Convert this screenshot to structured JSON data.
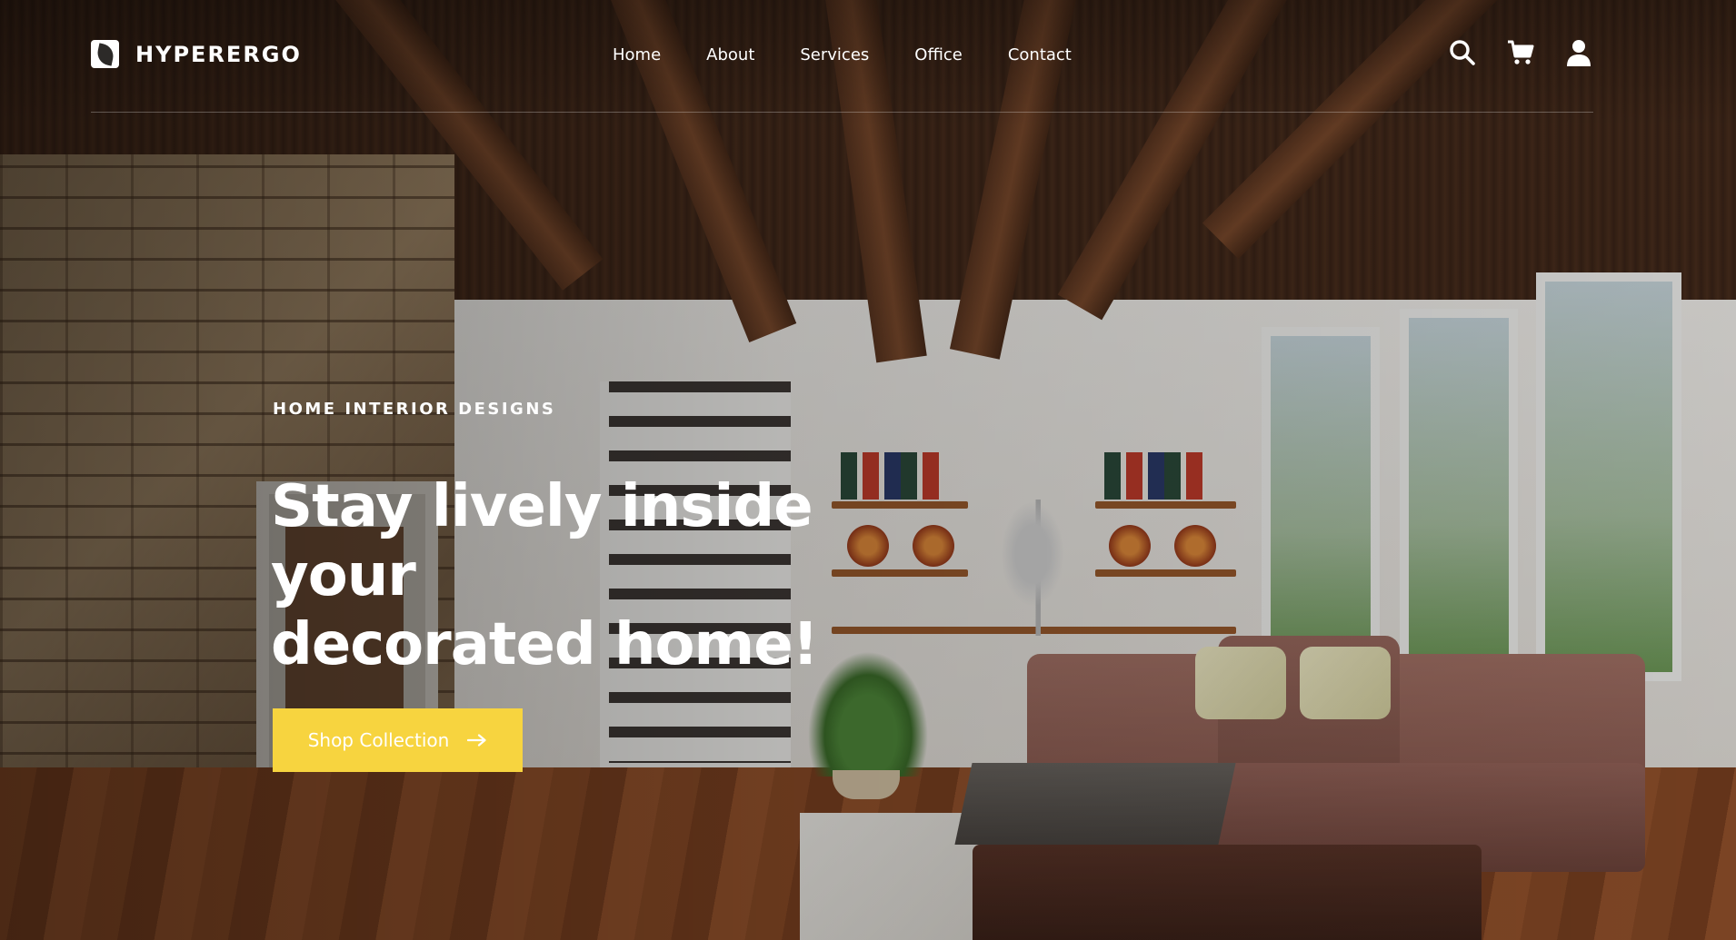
{
  "brand": {
    "name": "HYPERERGO",
    "logo_icon": "leaf-logo-icon"
  },
  "nav": {
    "items": [
      {
        "label": "Home"
      },
      {
        "label": "About"
      },
      {
        "label": "Services"
      },
      {
        "label": "Office"
      },
      {
        "label": "Contact"
      }
    ]
  },
  "header_icons": [
    "search-icon",
    "cart-icon",
    "user-icon"
  ],
  "hero": {
    "eyebrow": "HOME INTERIOR DESIGNS",
    "headline_line1": "Stay lively inside your",
    "headline_line2": "decorated home!",
    "cta_label": "Shop Collection",
    "cta_icon": "arrow-right-icon"
  },
  "colors": {
    "accent": "#f7d43f",
    "text": "#ffffff"
  }
}
